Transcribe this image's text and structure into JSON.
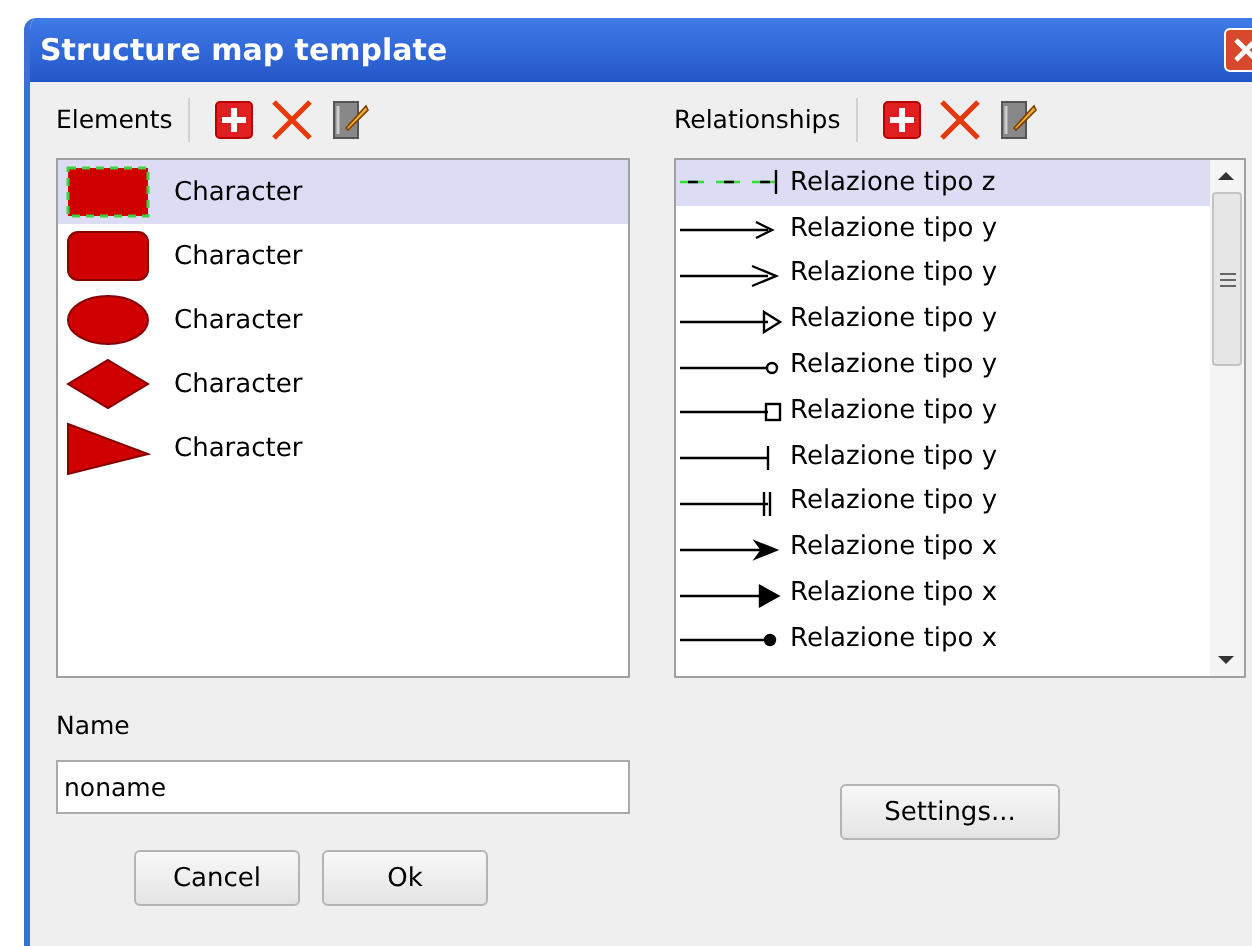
{
  "window": {
    "title": "Structure map template"
  },
  "elements": {
    "label": "Elements",
    "items": [
      {
        "kind": "rect-dashed",
        "label": "Character",
        "selected": true
      },
      {
        "kind": "rounded-rect",
        "label": "Character",
        "selected": false
      },
      {
        "kind": "ellipse",
        "label": "Character",
        "selected": false
      },
      {
        "kind": "diamond",
        "label": "Character",
        "selected": false
      },
      {
        "kind": "triangle",
        "label": "Character",
        "selected": false
      }
    ]
  },
  "relationships": {
    "label": "Relationships",
    "items": [
      {
        "kind": "dashed",
        "label": "Relazione tipo z",
        "selected": true
      },
      {
        "kind": "open-arrow-small",
        "label": "Relazione tipo y",
        "selected": false
      },
      {
        "kind": "open-arrow",
        "label": "Relazione tipo y",
        "selected": false
      },
      {
        "kind": "open-triangle",
        "label": "Relazione tipo y",
        "selected": false
      },
      {
        "kind": "circle",
        "label": "Relazione tipo y",
        "selected": false
      },
      {
        "kind": "square",
        "label": "Relazione tipo y",
        "selected": false
      },
      {
        "kind": "bar",
        "label": "Relazione tipo y",
        "selected": false
      },
      {
        "kind": "double-bar",
        "label": "Relazione tipo y",
        "selected": false
      },
      {
        "kind": "filled-arrow",
        "label": "Relazione tipo x",
        "selected": false
      },
      {
        "kind": "filled-triangle",
        "label": "Relazione tipo x",
        "selected": false
      },
      {
        "kind": "dot",
        "label": "Relazione tipo x",
        "selected": false
      }
    ]
  },
  "name": {
    "label": "Name",
    "value": "noname"
  },
  "buttons": {
    "settings": "Settings...",
    "cancel": "Cancel",
    "ok": "Ok"
  }
}
